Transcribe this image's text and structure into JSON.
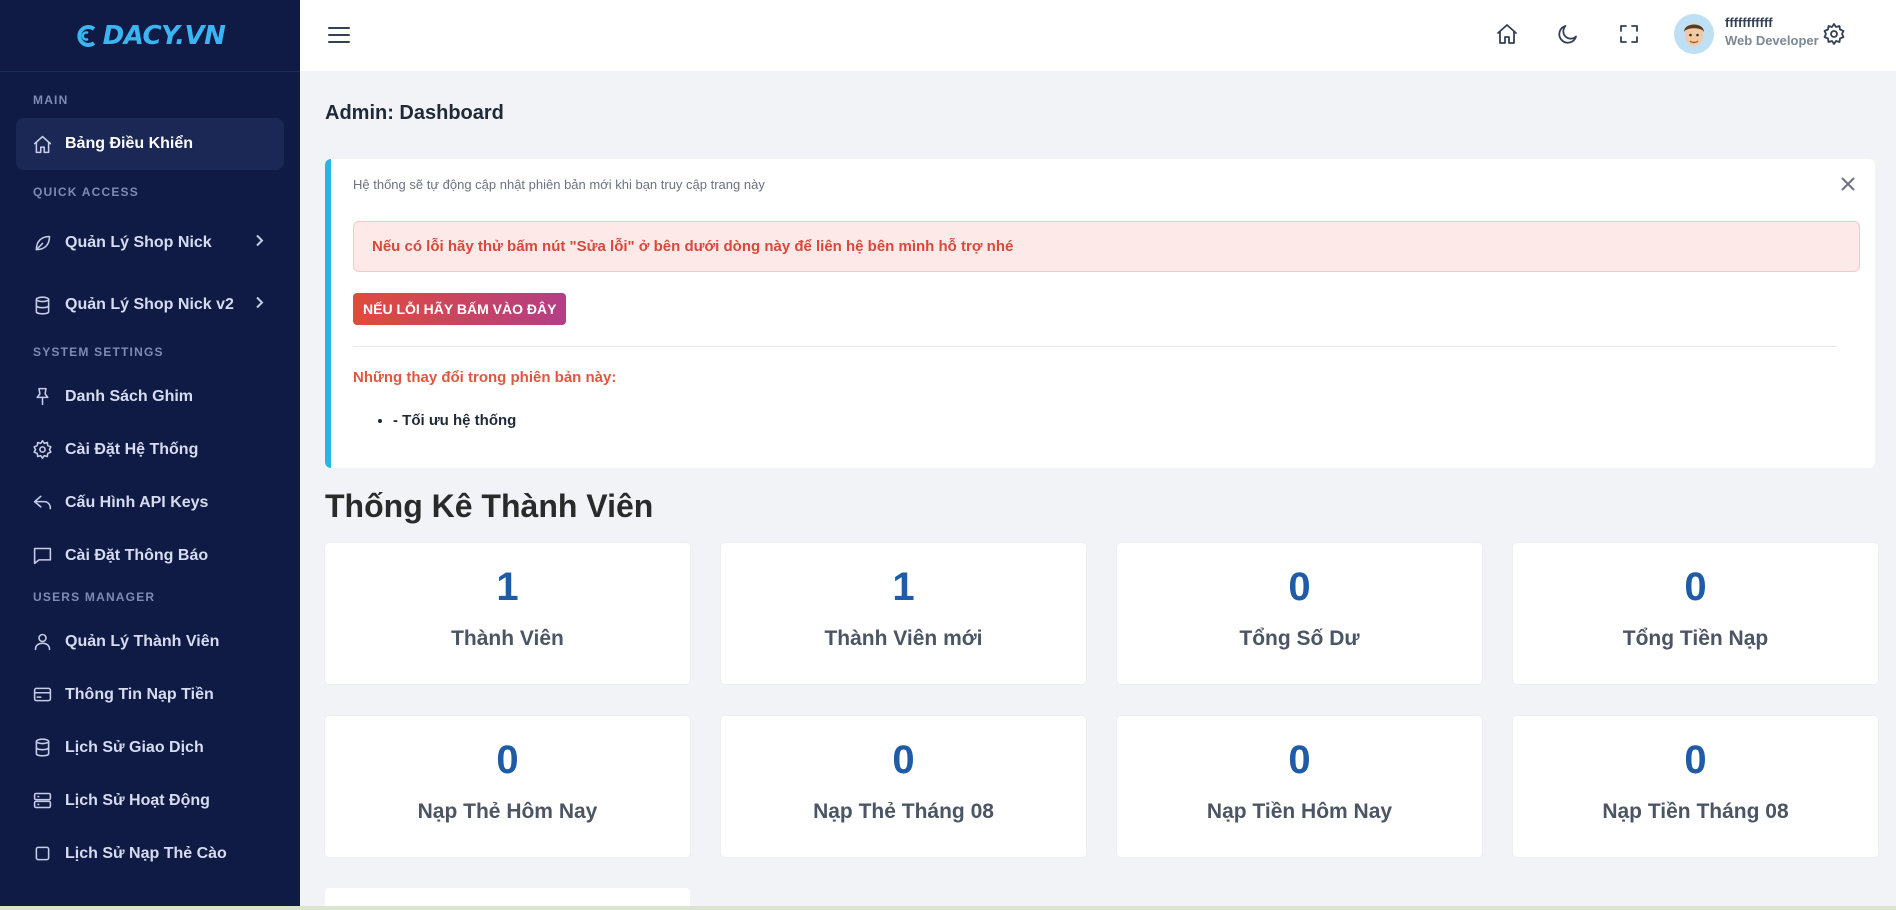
{
  "brand": {
    "logo_text": "DACY.VN",
    "color": "#3bb4f2"
  },
  "sidebar": {
    "sections": {
      "main": "MAIN",
      "quick_access": "QUICK ACCESS",
      "system_settings": "SYSTEM SETTINGS",
      "users_manager": "USERS MANAGER"
    },
    "items": [
      {
        "label": "Bảng Điều Khiển",
        "icon": "home-icon"
      },
      {
        "label": "Quản Lý Shop Nick",
        "icon": "leaf-icon"
      },
      {
        "label": "Quản Lý Shop Nick v2",
        "icon": "cylinder-icon"
      },
      {
        "label": "Danh Sách Ghim",
        "icon": "pin-icon"
      },
      {
        "label": "Cài Đặt Hệ Thống",
        "icon": "gear-icon"
      },
      {
        "label": "Cấu Hình API Keys",
        "icon": "reply-icon"
      },
      {
        "label": "Cài Đặt Thông Báo",
        "icon": "chat-icon"
      },
      {
        "label": "Quản Lý Thành Viên",
        "icon": "user-icon"
      },
      {
        "label": "Thông Tin Nạp Tiền",
        "icon": "card-icon"
      },
      {
        "label": "Lịch Sử Giao Dịch",
        "icon": "database-icon"
      },
      {
        "label": "Lịch Sử Hoạt Động",
        "icon": "server-icon"
      },
      {
        "label": "Lịch Sử Nạp Thẻ Cào",
        "icon": "square-icon"
      }
    ]
  },
  "header": {
    "user": {
      "name": "fffffffffff",
      "role": "Web Developer"
    }
  },
  "main": {
    "page_title": "Admin: Dashboard",
    "notice": {
      "text": "Hệ thống sẽ tự động cập nhật phiên bản mới khi bạn truy cập trang này",
      "alert": "Nếu có lỗi hãy thử bấm nút \"Sửa lỗi\" ở bên dưới dòng này để liên hệ bên mình hỗ trợ nhé",
      "fix_button": "NẾU LỖI HÃY BẤM VÀO ĐÂY",
      "changes_title": "Những thay đổi trong phiên bản này:",
      "changes": [
        "- Tối ưu hệ thống"
      ]
    },
    "stats_title": "Thống Kê Thành Viên",
    "stats": [
      {
        "value": "1",
        "label": "Thành Viên"
      },
      {
        "value": "1",
        "label": "Thành Viên mới"
      },
      {
        "value": "0",
        "label": "Tổng Số Dư"
      },
      {
        "value": "0",
        "label": "Tổng Tiền Nạp"
      },
      {
        "value": "0",
        "label": "Nạp Thẻ Hôm Nay"
      },
      {
        "value": "0",
        "label": "Nạp Thẻ Tháng 08"
      },
      {
        "value": "0",
        "label": "Nạp Tiền Hôm Nay"
      },
      {
        "value": "0",
        "label": "Nạp Tiền Tháng 08"
      }
    ]
  },
  "colors": {
    "sidebar_bg": "#101b45",
    "accent": "#29b6e6",
    "stat_value": "#1f5ca5",
    "alert_text": "#d9483b"
  }
}
